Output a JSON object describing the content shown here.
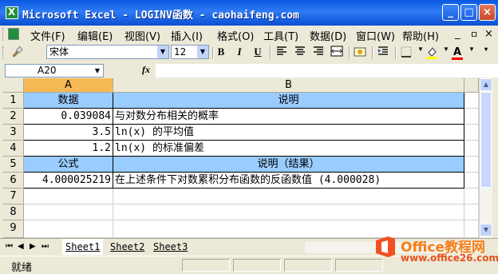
{
  "window": {
    "title": "Microsoft Excel - LOGINV函数 - caohaifeng.com",
    "minimize_glyph": "_",
    "maximize_glyph": "□",
    "close_glyph": "×"
  },
  "menu": {
    "items": [
      "文件(F)",
      "编辑(E)",
      "视图(V)",
      "插入(I)",
      "格式(O)",
      "工具(T)",
      "数据(D)",
      "窗口(W)",
      "帮助(H)"
    ],
    "doc_minimize": "_",
    "doc_restore": "ㅁ",
    "doc_close": "×"
  },
  "toolbar": {
    "font_name": "宋体",
    "font_size": "12",
    "bold": "B",
    "italic": "I",
    "underline": "U",
    "font_color": "A",
    "icons": [
      "brush-icon",
      "align-left-icon",
      "align-center-icon",
      "align-right-icon",
      "merge-center-icon",
      "currency-icon",
      "indent-icon",
      "borders-icon",
      "fill-color-icon",
      "font-color-icon"
    ]
  },
  "formula_bar": {
    "name_box": "A20",
    "fx_label": "fx",
    "formula": ""
  },
  "sheet": {
    "columns": [
      "A",
      "B"
    ],
    "selected_column": "A",
    "rows": [
      {
        "num": "1",
        "a": "数据",
        "b": "说明",
        "style": "header"
      },
      {
        "num": "2",
        "a": "0.039084",
        "b": "与对数分布相关的概率",
        "style": "data"
      },
      {
        "num": "3",
        "a": "3.5",
        "b": "ln(x) 的平均值",
        "style": "data"
      },
      {
        "num": "4",
        "a": "1.2",
        "b": "ln(x) 的标准偏差",
        "style": "data"
      },
      {
        "num": "5",
        "a": "公式",
        "b": "说明（结果）",
        "style": "header"
      },
      {
        "num": "6",
        "a": "4.000025219",
        "b": "在上述条件下对数累积分布函数的反函数值 (4.000028)",
        "style": "data"
      },
      {
        "num": "7",
        "a": "",
        "b": "",
        "style": "empty"
      },
      {
        "num": "8",
        "a": "",
        "b": "",
        "style": "empty"
      },
      {
        "num": "9",
        "a": "",
        "b": "",
        "style": "empty"
      }
    ],
    "header_fill": "#99ccff",
    "selected_header_fill": "#f7b955"
  },
  "tabs": {
    "nav": [
      "⏮",
      "◀",
      "▶",
      "⏭"
    ],
    "sheets": [
      "Sheet1",
      "Sheet2",
      "Sheet3"
    ],
    "active": "Sheet1"
  },
  "status": {
    "text": "就绪"
  },
  "watermark": {
    "title": "Office教程网",
    "url": "www.office26.com"
  }
}
